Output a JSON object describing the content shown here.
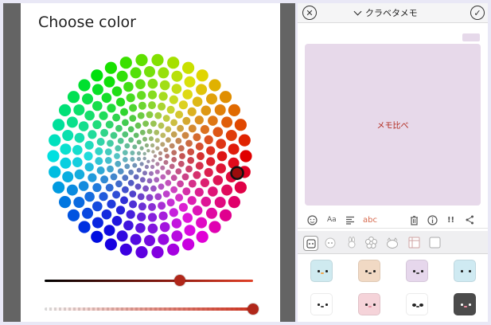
{
  "left": {
    "title": "Choose color",
    "brightness": 0.65,
    "alpha": 1.0,
    "selected_color": "#9b0c0c"
  },
  "right": {
    "header": {
      "title": "クラベタメモ",
      "close_icon": "close-circle-icon",
      "confirm_icon": "check-circle-icon"
    },
    "memo": {
      "text": "メモ比べ",
      "bg_color": "#e7d9ea",
      "text_color": "#b0271a"
    },
    "toolbar1": {
      "font_size_label": "Aa",
      "color_text_label": "abc",
      "exclaim_label": "!!"
    },
    "sticker_colors": [
      "#cfeaf0",
      "#f1d9c4",
      "#e6d7ec",
      "#cfeaf2",
      "#ffffff",
      "#f5d3d9",
      "#ffffff",
      "#4b4b4b"
    ]
  }
}
